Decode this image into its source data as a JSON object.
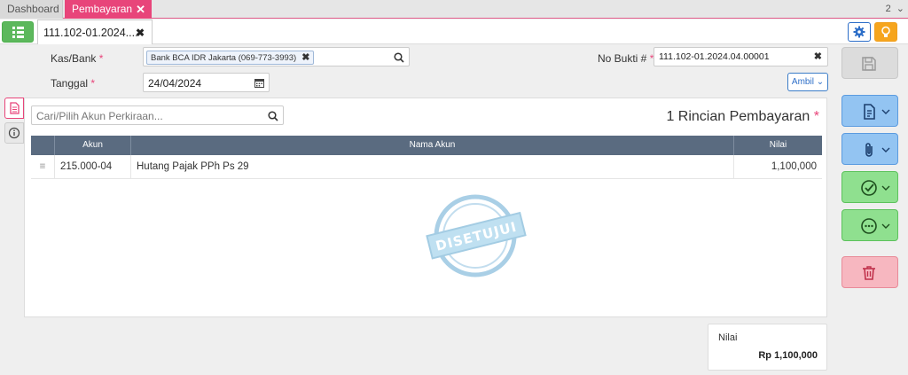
{
  "tabs": {
    "dashboard": "Dashboard",
    "active": "Pembayaran",
    "overflow_count": "2"
  },
  "doc": {
    "tab_label": "111.102-01.2024...."
  },
  "form": {
    "kasbank_label": "Kas/Bank",
    "kasbank_value": "Bank BCA IDR Jakarta (069-773-3993)",
    "tanggal_label": "Tanggal",
    "tanggal_value": "24/04/2024",
    "nobukti_label": "No Bukti #",
    "nobukti_value": "111.102-01.2024.04.00001",
    "required_mark": "*",
    "ambil_label": "Ambil"
  },
  "panel": {
    "search_placeholder": "Cari/Pilih Akun Perkiraan...",
    "title": "1 Rincian Pembayaran",
    "columns": [
      "Akun",
      "Nama Akun",
      "Nilai"
    ],
    "rows": [
      {
        "akun": "215.000-04",
        "nama": "Hutang Pajak PPh Ps 29",
        "nilai": "1,100,000"
      }
    ],
    "stamp_text": "DISETUJUI"
  },
  "summary": {
    "label": "Nilai",
    "value": "Rp 1,100,000"
  },
  "icons": {
    "list": "list-icon",
    "gear": "gear-icon",
    "bulb": "lightbulb-icon",
    "save": "save-icon",
    "document": "document-icon",
    "attachment": "paperclip-icon",
    "approve": "check-circle-icon",
    "more": "more-icon",
    "delete": "trash-icon"
  },
  "colors": {
    "accent_pink": "#e8457a",
    "header_slate": "#5a6b80",
    "green": "#5cb85c",
    "blue": "#2d6ec8",
    "orange": "#f6a51d"
  }
}
